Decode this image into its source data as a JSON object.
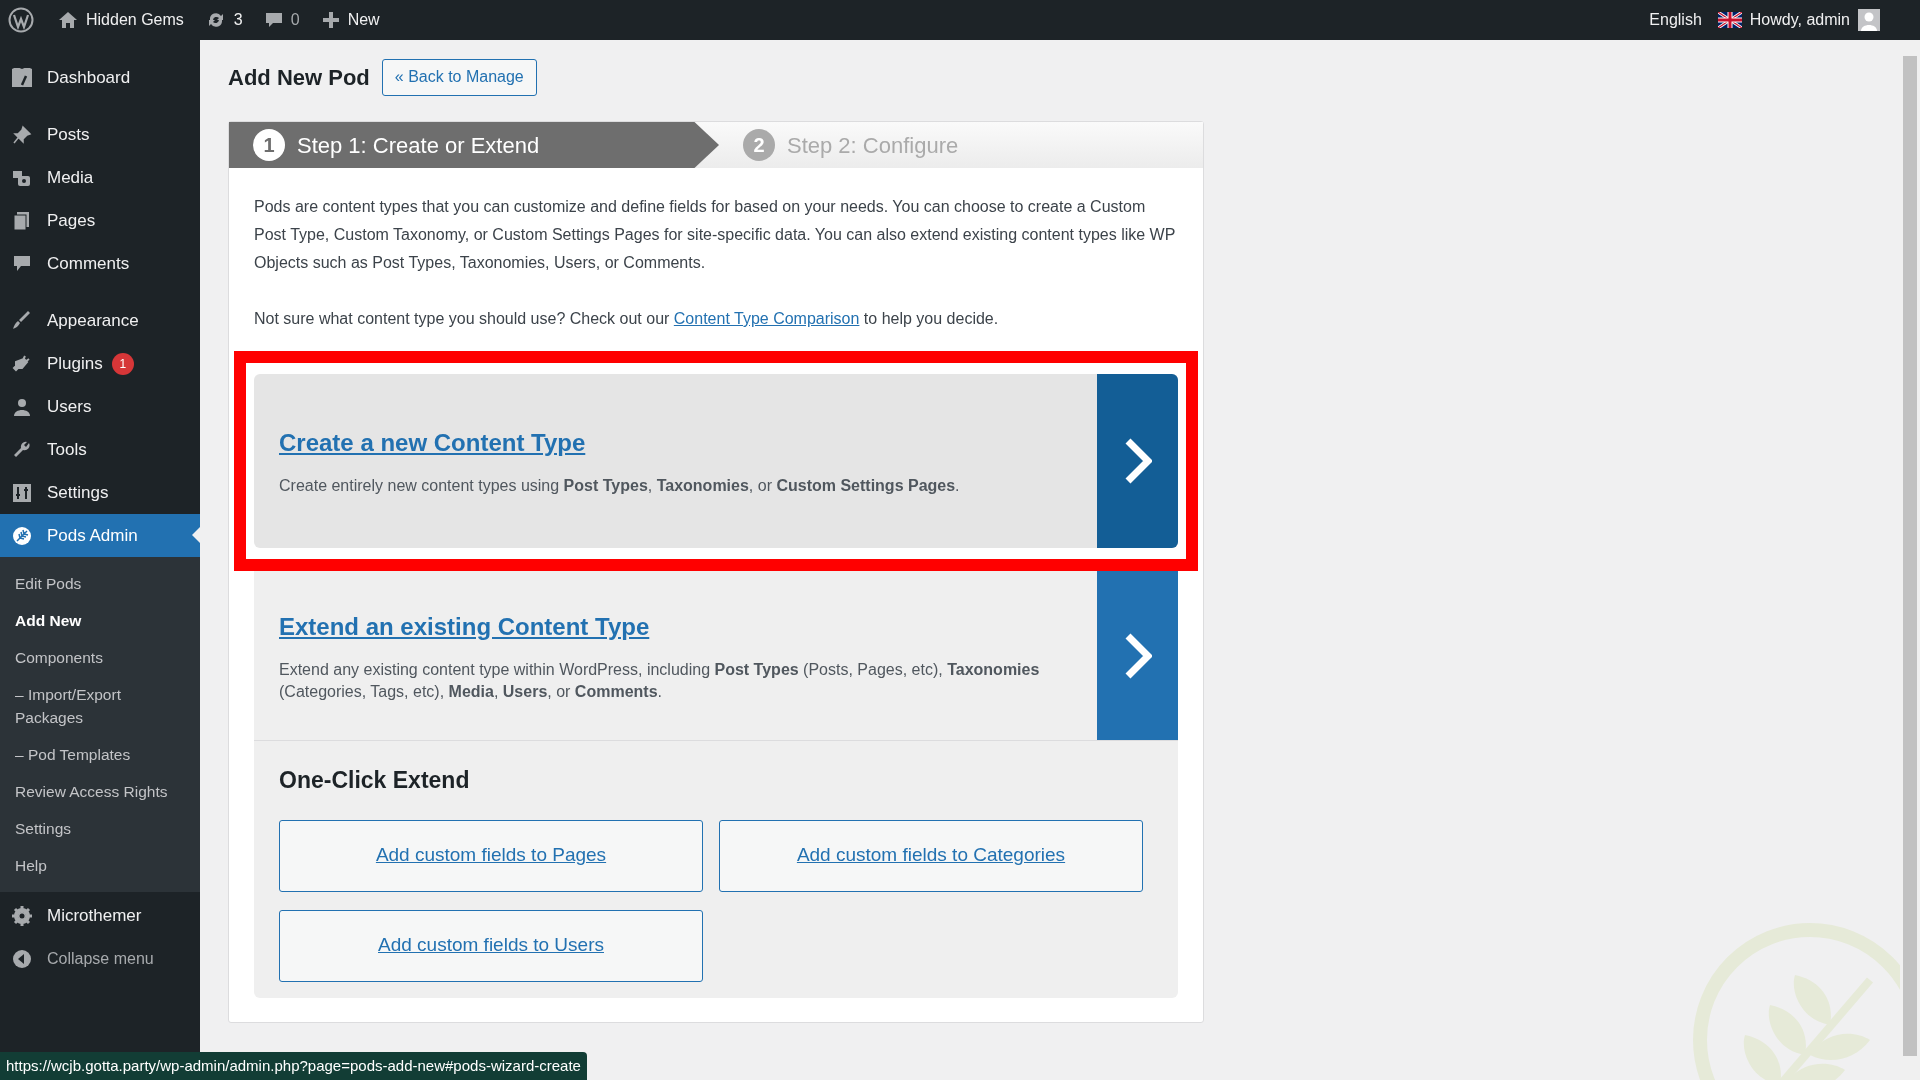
{
  "admin_bar": {
    "site": "Hidden Gems",
    "updates": "3",
    "comments": "0",
    "new": "New",
    "language": "English",
    "greeting": "Howdy, admin"
  },
  "sidebar": {
    "menu": [
      {
        "label": "Dashboard",
        "selected": false,
        "gap_after": true
      },
      {
        "label": "Posts",
        "selected": false
      },
      {
        "label": "Media",
        "selected": false
      },
      {
        "label": "Pages",
        "selected": false
      },
      {
        "label": "Comments",
        "selected": false,
        "gap_after": true
      },
      {
        "label": "Appearance",
        "selected": false
      },
      {
        "label": "Plugins",
        "selected": false,
        "badge": "1"
      },
      {
        "label": "Users",
        "selected": false
      },
      {
        "label": "Tools",
        "selected": false
      },
      {
        "label": "Settings",
        "selected": false
      },
      {
        "label": "Pods Admin",
        "selected": true,
        "children": [
          {
            "label": "Edit Pods",
            "selected": false
          },
          {
            "label": "Add New",
            "selected": true
          },
          {
            "label": "Components",
            "selected": false
          },
          {
            "label": "– Import/Export Packages",
            "selected": false
          },
          {
            "label": "– Pod Templates",
            "selected": false
          },
          {
            "label": "Review Access Rights",
            "selected": false
          },
          {
            "label": "Settings",
            "selected": false
          },
          {
            "label": "Help",
            "selected": false
          }
        ]
      },
      {
        "label": "Microthemer",
        "selected": false
      }
    ],
    "collapse": "Collapse menu"
  },
  "page": {
    "title": "Add New Pod",
    "back_button": "« Back to Manage"
  },
  "wizard": {
    "steps": [
      {
        "number": "1",
        "label": "Step 1: Create or Extend",
        "selected": true
      },
      {
        "number": "2",
        "label": "Step 2: Configure",
        "selected": false
      }
    ],
    "intro": "Pods are content types that you can customize and define fields for based on your needs. You can choose to create a Custom Post Type, Custom Taxonomy, or Custom Settings Pages for site-specific data. You can also extend existing content types like WP Objects such as Post Types, Taxonomies, Users, or Comments.",
    "help": {
      "before": "Not sure what content type you should use? Check out our",
      "link": "Content Type Comparison",
      "after": "to help you decide."
    },
    "options": [
      {
        "title": "Create a new Content Type",
        "description": "Create entirely new content types using **Post Types**, **Taxonomies**, or **Custom Settings Pages**.",
        "highlighted": true
      },
      {
        "title": "Extend an existing Content Type",
        "description": "Extend any existing content type within WordPress, including **Post Types** (Posts, Pages, etc), **Taxonomies** (Categories, Tags, etc), **Media**, **Users**, or **Comments**.",
        "highlighted": false
      }
    ],
    "one_click": {
      "heading": "One-Click Extend",
      "buttons": [
        "Add custom fields to Pages",
        "Add custom fields to Categories",
        "Add custom fields to Users"
      ]
    }
  },
  "status_url": "https://wcjb.gotta.party/wp-admin/admin.php?page=pods-add-new#pods-wizard-create"
}
